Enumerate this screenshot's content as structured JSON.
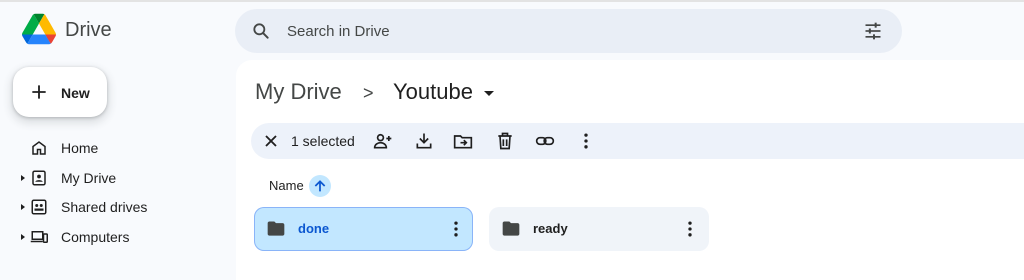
{
  "app": {
    "name": "Drive",
    "logo": "google-drive-logo"
  },
  "search": {
    "placeholder": "Search in Drive",
    "value": "",
    "icon": "search-icon",
    "options_icon": "tune-icon"
  },
  "new_button": {
    "label": "New",
    "icon": "plus-icon"
  },
  "sidebar": {
    "items": [
      {
        "label": "Home",
        "icon": "home-icon",
        "expandable": false
      },
      {
        "label": "My Drive",
        "icon": "my-drive-icon",
        "expandable": true
      },
      {
        "label": "Shared drives",
        "icon": "shared-drives-icon",
        "expandable": true
      },
      {
        "label": "Computers",
        "icon": "computers-icon",
        "expandable": true
      }
    ]
  },
  "breadcrumb": {
    "root": "My Drive",
    "separator": ">",
    "current": "Youtube"
  },
  "selection_bar": {
    "count_label": "1 selected",
    "actions": [
      "clear-selection",
      "share",
      "download",
      "move",
      "delete",
      "copy-link",
      "more-actions"
    ]
  },
  "list": {
    "sort_column": "Name",
    "sort_direction": "ascending",
    "folders": [
      {
        "name": "done",
        "selected": true
      },
      {
        "name": "ready",
        "selected": false
      }
    ]
  },
  "colors": {
    "background": "#f8fafd",
    "search_bg": "#e9eef6",
    "selection_bar_bg": "#edf2fa",
    "selected_item_bg": "#c2e7ff",
    "selected_text": "#0b57d0",
    "folder_bg": "#f0f4f9"
  }
}
